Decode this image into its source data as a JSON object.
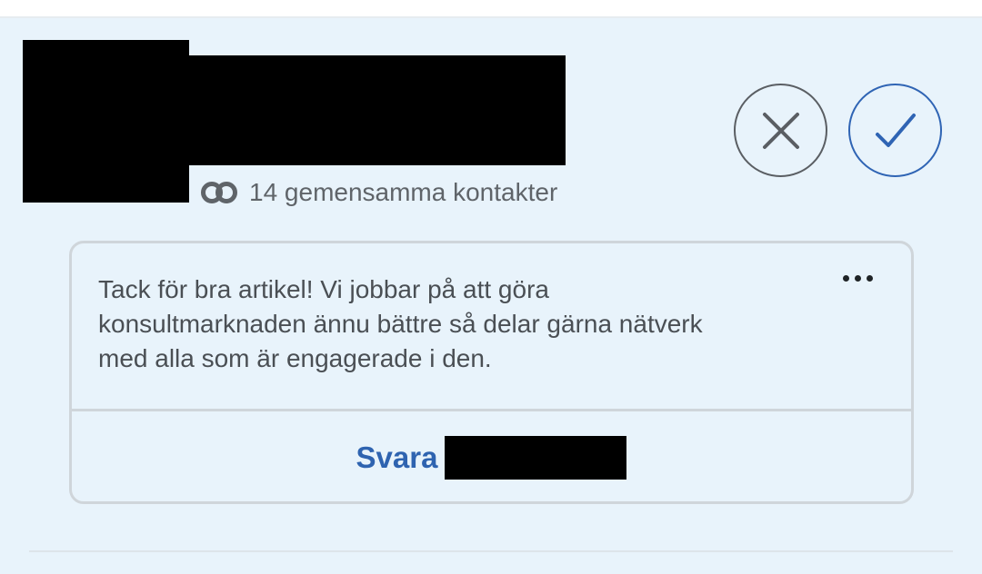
{
  "invitation": {
    "mutual_connections_text": "14 gemensamma kontakter",
    "message": "Tack för bra artikel! Vi jobbar på att göra konsultmarknaden ännu bättre så delar gärna nätverk med alla som är engagerade i den.",
    "reply_label": "Svara",
    "icons": {
      "mutual": "mutual-connections-icon",
      "ignore": "close-icon",
      "accept": "checkmark-icon",
      "more": "more-horizontal-icon"
    },
    "colors": {
      "background": "#e8f3fb",
      "accent": "#2e63b0",
      "muted_text": "#5f6469",
      "border": "#cfd5da"
    }
  }
}
